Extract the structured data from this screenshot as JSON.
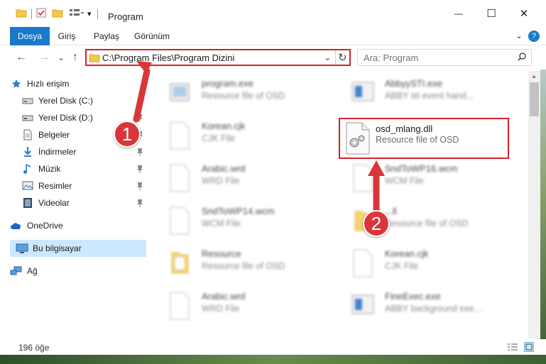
{
  "window": {
    "title": "Program",
    "minimize_glyph": "—",
    "maximize_glyph": "☐",
    "close_glyph": "✕"
  },
  "ribbon": {
    "tabs": [
      {
        "label": "Dosya",
        "active": true
      },
      {
        "label": "Giriş",
        "active": false
      },
      {
        "label": "Paylaş",
        "active": false
      },
      {
        "label": "Görünüm",
        "active": false
      }
    ],
    "help_glyph": "?"
  },
  "navigation": {
    "back_glyph": "←",
    "forward_glyph": "→",
    "recent_glyph": "⌄",
    "up_glyph": "↑",
    "address": "C:\\Program Files\\Program Dizini",
    "dropdown_glyph": "⌄",
    "refresh_glyph": "↻",
    "search_placeholder": "Ara: Program"
  },
  "sidebar": {
    "items": [
      {
        "label": "Hızlı erişim",
        "icon": "star-icon"
      },
      {
        "label": "Yerel Disk (C:)",
        "icon": "drive-icon"
      },
      {
        "label": "Yerel Disk (D:)",
        "icon": "drive-icon"
      },
      {
        "label": "Belgeler",
        "icon": "documents-icon"
      },
      {
        "label": "İndirmeler",
        "icon": "download-icon"
      },
      {
        "label": "Müzik",
        "icon": "music-icon"
      },
      {
        "label": "Resimler",
        "icon": "pictures-icon"
      },
      {
        "label": "Videolar",
        "icon": "video-icon"
      },
      {
        "label": "OneDrive",
        "icon": "cloud-icon"
      },
      {
        "label": "Bu bilgisayar",
        "icon": "computer-icon"
      },
      {
        "label": "Ağ",
        "icon": "network-icon"
      }
    ]
  },
  "files": [
    {
      "name": "program.exe",
      "type": "Resource file of OSD"
    },
    {
      "name": "AbbyySTI.exe",
      "type": "ABBY sti event hand..."
    },
    {
      "name": "Korean.cjk",
      "type": "CJK File"
    },
    {
      "name": "osd_mlang.dll",
      "type": "Resource file of OSD"
    },
    {
      "name": "Arabic.wrd",
      "type": "WRD File"
    },
    {
      "name": "SndToWP16.wcm",
      "type": "WCM File"
    },
    {
      "name": "SndToWP14.wcm",
      "type": "WCM File"
    },
    {
      "name": "...ll",
      "type": "Resource file of OSD"
    },
    {
      "name": "Resource",
      "type": "Resource file of OSD"
    },
    {
      "name": "Korean.cjk",
      "type": "CJK File"
    },
    {
      "name": "Arabic.wrd",
      "type": "WRD File"
    },
    {
      "name": "FineExec.exe",
      "type": "ABBY background exe..."
    }
  ],
  "status": {
    "item_count": "196 öğe"
  },
  "annotations": {
    "step1": "1",
    "step2": "2"
  },
  "colors": {
    "accent": "#1979ca",
    "highlight_red": "#d3232b",
    "selection": "#cce8ff"
  }
}
